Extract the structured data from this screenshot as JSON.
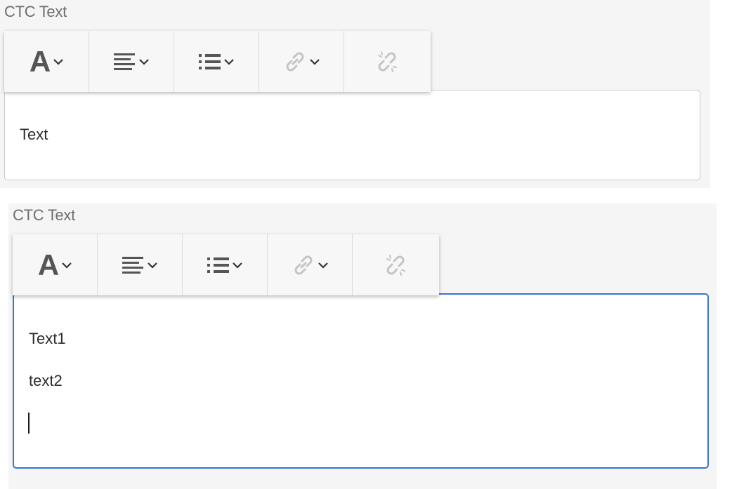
{
  "editors": [
    {
      "label": "CTC Text",
      "lines": [
        "Text"
      ],
      "focused": false
    },
    {
      "label": "CTC Text",
      "lines": [
        "Text1",
        "text2"
      ],
      "focused": true
    }
  ],
  "toolbar": {
    "icons": [
      "text-format-icon",
      "align-left-icon",
      "list-icon",
      "link-icon",
      "unlink-icon"
    ],
    "font_glyph": "A"
  },
  "colors": {
    "focus_border": "#3b73d3",
    "icon_dark": "#555555",
    "icon_disabled": "#c4c4c4"
  }
}
